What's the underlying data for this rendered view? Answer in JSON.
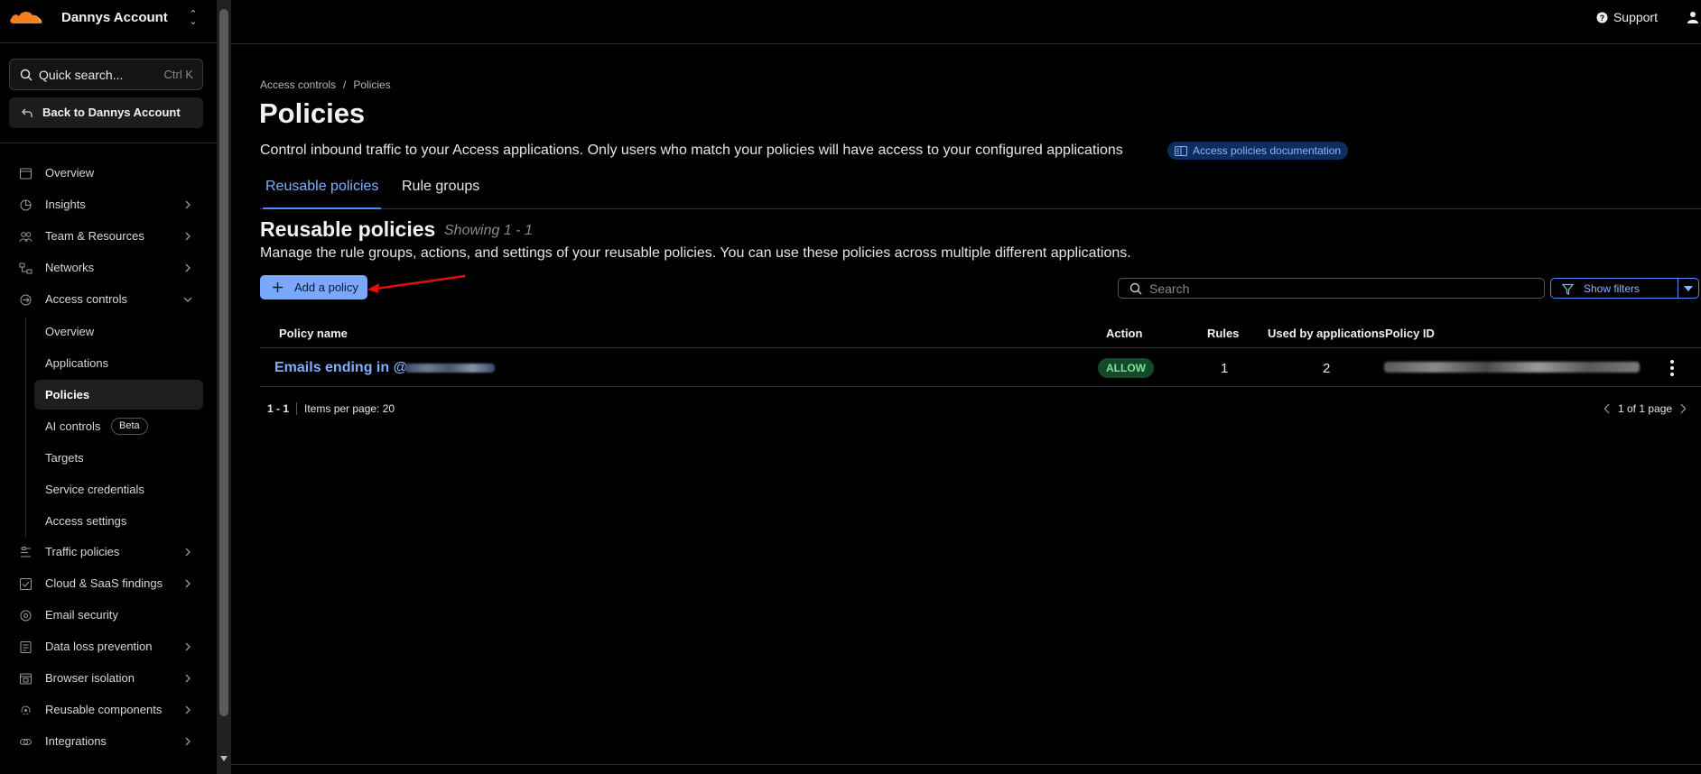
{
  "account": {
    "name": "Dannys Account"
  },
  "sidebar": {
    "quick_search": {
      "label": "Quick search...",
      "shortcut": "Ctrl K"
    },
    "back_label": "Back to Dannys Account",
    "items": [
      {
        "label": "Overview"
      },
      {
        "label": "Insights"
      },
      {
        "label": "Team & Resources"
      },
      {
        "label": "Networks"
      },
      {
        "label": "Access controls"
      },
      {
        "label": "Traffic policies"
      },
      {
        "label": "Cloud & SaaS findings"
      },
      {
        "label": "Email security"
      },
      {
        "label": "Data loss prevention"
      },
      {
        "label": "Browser isolation"
      },
      {
        "label": "Reusable components"
      },
      {
        "label": "Integrations"
      }
    ],
    "access_sub": [
      {
        "label": "Overview"
      },
      {
        "label": "Applications"
      },
      {
        "label": "Policies"
      },
      {
        "label": "AI controls",
        "badge": "Beta"
      },
      {
        "label": "Targets"
      },
      {
        "label": "Service credentials"
      },
      {
        "label": "Access settings"
      }
    ]
  },
  "topbar": {
    "support": "Support"
  },
  "breadcrumb": {
    "parent": "Access controls",
    "sep": "/",
    "current": "Policies"
  },
  "page": {
    "title": "Policies",
    "description": "Control inbound traffic to your Access applications. Only users who match your policies will have access to your configured applications",
    "doc_link": "Access policies documentation"
  },
  "tabs": [
    {
      "label": "Reusable policies"
    },
    {
      "label": "Rule groups"
    }
  ],
  "section": {
    "title": "Reusable policies",
    "showing": "Showing 1 - 1",
    "description": "Manage the rule groups, actions, and settings of your reusable policies. You can use these policies across multiple different applications."
  },
  "toolbar": {
    "add_label": "Add a policy",
    "search_placeholder": "Search",
    "filters_label": "Show filters"
  },
  "table": {
    "headers": [
      "Policy name",
      "Action",
      "Rules",
      "Used by applications",
      "Policy ID"
    ],
    "rows": [
      {
        "name": "Emails ending in @",
        "action": "ALLOW",
        "rules": "1",
        "apps": "2"
      }
    ]
  },
  "pagination": {
    "range": "1 - 1",
    "per_page": "Items per page: 20",
    "page_info": "1 of 1 page"
  },
  "colors": {
    "accent": "#4a8cff",
    "allow": "#7fe0a0",
    "brand": "#f38020",
    "annotation": "#e01010"
  }
}
